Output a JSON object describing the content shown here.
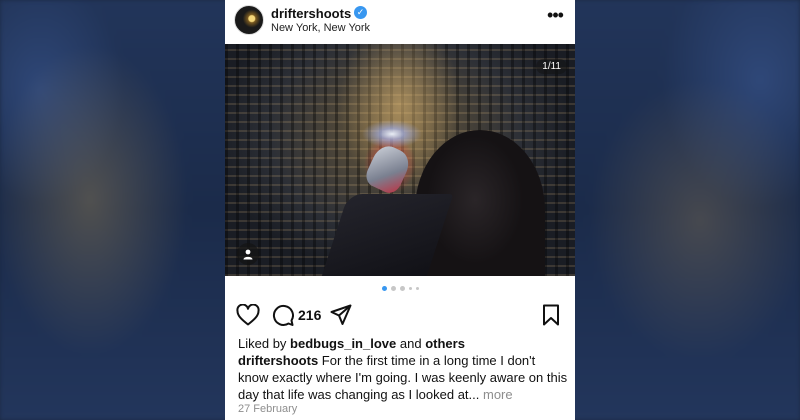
{
  "post": {
    "username": "driftershoots",
    "location": "New York, New York",
    "image_counter": "1/11",
    "carousel": {
      "total_dots_visible": 5,
      "active_index": 0
    },
    "comment_count": "216",
    "liked_by_prefix": "Liked by",
    "liked_by_user": "bedbugs_in_love",
    "liked_by_and": "and",
    "liked_by_others": "others",
    "caption_author": "driftershoots",
    "caption_text": "For the first time in a long time I don't know exactly where I'm going. I was keenly aware on this day that life was changing as I looked at...",
    "caption_more": "more",
    "date": "27 February"
  },
  "colors": {
    "accent": "#3897f0",
    "verified": "#3897f0",
    "muted_text": "#8e8e8e"
  },
  "icons": [
    "verified-badge-icon",
    "more-options-icon",
    "user-tag-icon",
    "heart-icon",
    "comment-icon",
    "share-icon",
    "bookmark-icon"
  ]
}
